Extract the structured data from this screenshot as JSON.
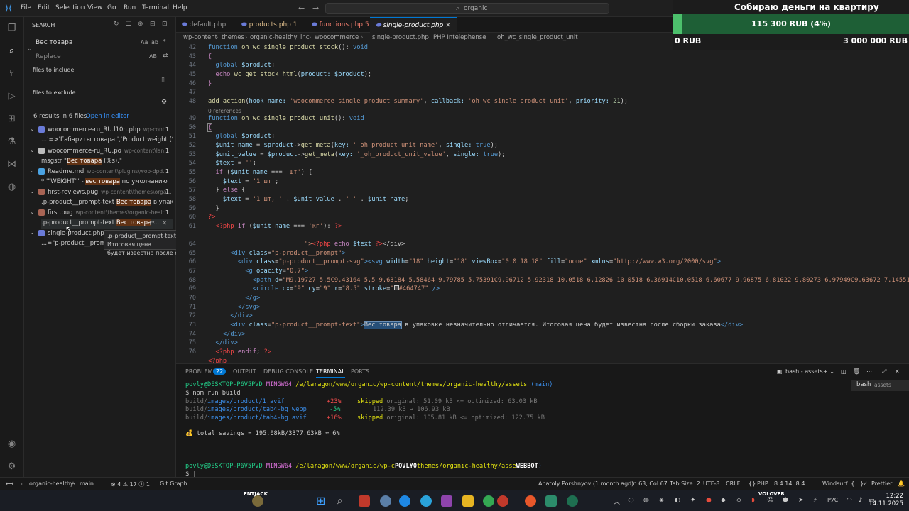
{
  "menu": [
    "File",
    "Edit",
    "Selection",
    "View",
    "Go",
    "Run",
    "Terminal",
    "Help"
  ],
  "command_center": "organic",
  "sidebar": {
    "title": "SEARCH",
    "search_value": "Вес товара",
    "replace_placeholder": "Replace",
    "replace_toggle": "AB",
    "match_case": "Aa",
    "whole_word": "ab",
    "files_include": "files to include",
    "files_exclude": "files to exclude",
    "results_summary": "6 results in 6 files - ",
    "open_in_editor": "Open in editor",
    "results": [
      {
        "file": "woocommerce-ru_RU.l10n.php",
        "path": "wp-cont...",
        "count": "1",
        "line_pre": "...'=>'Габариты товара.','Product weight (%s).'",
        "line_hl": "",
        "line_post": ""
      },
      {
        "file": "woocommerce-ru_RU.po",
        "path": "wp-content\\lan...",
        "count": "1",
        "line_pre": "msgstr \"",
        "line_hl": "Вес товара",
        "line_post": " (%s).\""
      },
      {
        "file": "Readme.md",
        "path": "wp-content\\plugins\\woo-dpd...",
        "count": "1",
        "line_pre": "* '\"WEIGHT\"' - ",
        "line_hl": "вес товара",
        "line_post": " по умолчанию"
      },
      {
        "file": "first-reviews.pug",
        "path": "wp-content\\themes\\orga...",
        "count": "1",
        "line_pre": ".p-product__prompt-text ",
        "line_hl": "Вес товара",
        "line_post": " в упаковк..."
      },
      {
        "file": "first.pug",
        "path": "wp-content\\themes\\organic-healt...",
        "count": "1",
        "line_pre": ".p-product__prompt-text ",
        "line_hl": "Вес товара",
        "line_post": " ..."
      },
      {
        "file": "single-product.php",
        "path": "",
        "count": "",
        "line_pre": "...=\"p-product__promp",
        "line_hl": "",
        "line_post": ""
      }
    ],
    "tooltip_line1": ".p-product__prompt-text Вес товара в упаковке незначительно отличается. Итоговая цена",
    "tooltip_line2": "будет известна после сборки заказа"
  },
  "tabs": [
    {
      "label": "default.php",
      "badge": ""
    },
    {
      "label": "products.php",
      "badge": "1"
    },
    {
      "label": "functions.php",
      "badge": "5"
    },
    {
      "label": "single-product.php",
      "badge": ""
    }
  ],
  "breadcrumbs": [
    "wp-content",
    "themes",
    "organic-healthy",
    "inc",
    "woocommerce",
    "single-product.php",
    "PHP Intelephense",
    "oh_wc_single_product_unit"
  ],
  "editor": {
    "line_numbers": [
      "42",
      "43",
      "44",
      "45",
      "46",
      "47",
      "48",
      "",
      "49",
      "50",
      "51",
      "52",
      "53",
      "54",
      "55",
      "56",
      "57",
      "58",
      "59",
      "60",
      "61",
      "",
      "64",
      "65",
      "66",
      "67",
      "68",
      "69",
      "70",
      "71",
      "72",
      "73",
      "74",
      "75",
      "76"
    ],
    "references": "0 references"
  },
  "fundraiser": {
    "title": "Собираю деньги на квартиру",
    "amount": "115 300 RUB (4%)",
    "progress": 0.04,
    "min": "0 RUB",
    "max": "3 000 000 RUB"
  },
  "panel": {
    "tabs": [
      "PROBLEMS",
      "OUTPUT",
      "DEBUG CONSOLE",
      "TERMINAL",
      "PORTS"
    ],
    "problems_count": "22",
    "terminal_name": "bash - assets",
    "terminal_list_item": "bash",
    "terminal_list_sub": "assets",
    "prompt_user": "povly@DESKTOP-P6V5PVD",
    "prompt_shell": "MINGW64",
    "prompt_path": "/e/laragon/www/organic/wp-content/themes/organic-healthy/assets",
    "prompt_branch": "(main)",
    "command": "$ npm run build",
    "build_rows": [
      {
        "path_pre": "build/",
        "path_hl": "images/product/1.avif",
        "pct": "+23%",
        "status": "skipped",
        "detail": "original: 51.09 kB <= optimized: 63.03 kB"
      },
      {
        "path_pre": "build/",
        "path_hl": "images/product/tab4-bg.webp",
        "pct": "-5%",
        "status": "",
        "detail": "112.39 kB → 106.93 kB"
      },
      {
        "path_pre": "build/",
        "path_hl": "images/product/tab4-bg.avif",
        "pct": "+16%",
        "status": "skipped",
        "detail": "original: 105.81 kB <= optimized: 122.75 kB"
      }
    ],
    "savings": "💰 total savings = 195.08kB/3377.63kB ≈ 6%",
    "prompt2_path": "/e/laragon/www/organic/wp-c",
    "prompt2_tail": "themes/organic-healthy/asse",
    "overlay_a": "POVLY0",
    "overlay_b": "WEBBOT",
    "prompt_end": "$ |"
  },
  "statusbar": {
    "remote": "⟷",
    "folder": "organic-healthy",
    "branch": "main",
    "problems": "⊗ 4 ⚠ 17 ⓘ 1",
    "git_graph": "Git Graph",
    "blame": "Anatoly Porshnyov (1 month ago)",
    "position": "Ln 63, Col 67",
    "tabsize": "Tab Size: 2",
    "encoding": "UTF-8",
    "eol": "CRLF",
    "lang": "PHP",
    "php_ver": "8.4.14: 8.4",
    "windsurf": "Windsurf: {...}",
    "prettier": "Prettier"
  },
  "taskbar": {
    "lang": "РУС",
    "time": "12:22",
    "date": "14.11.2025",
    "label_left": "ENTJACK",
    "label_right": "VOLOVER"
  },
  "colors": {
    "accent": "#0078d4",
    "fund_fill": "#4cc06c",
    "fund_bg": "#1e5f36"
  }
}
